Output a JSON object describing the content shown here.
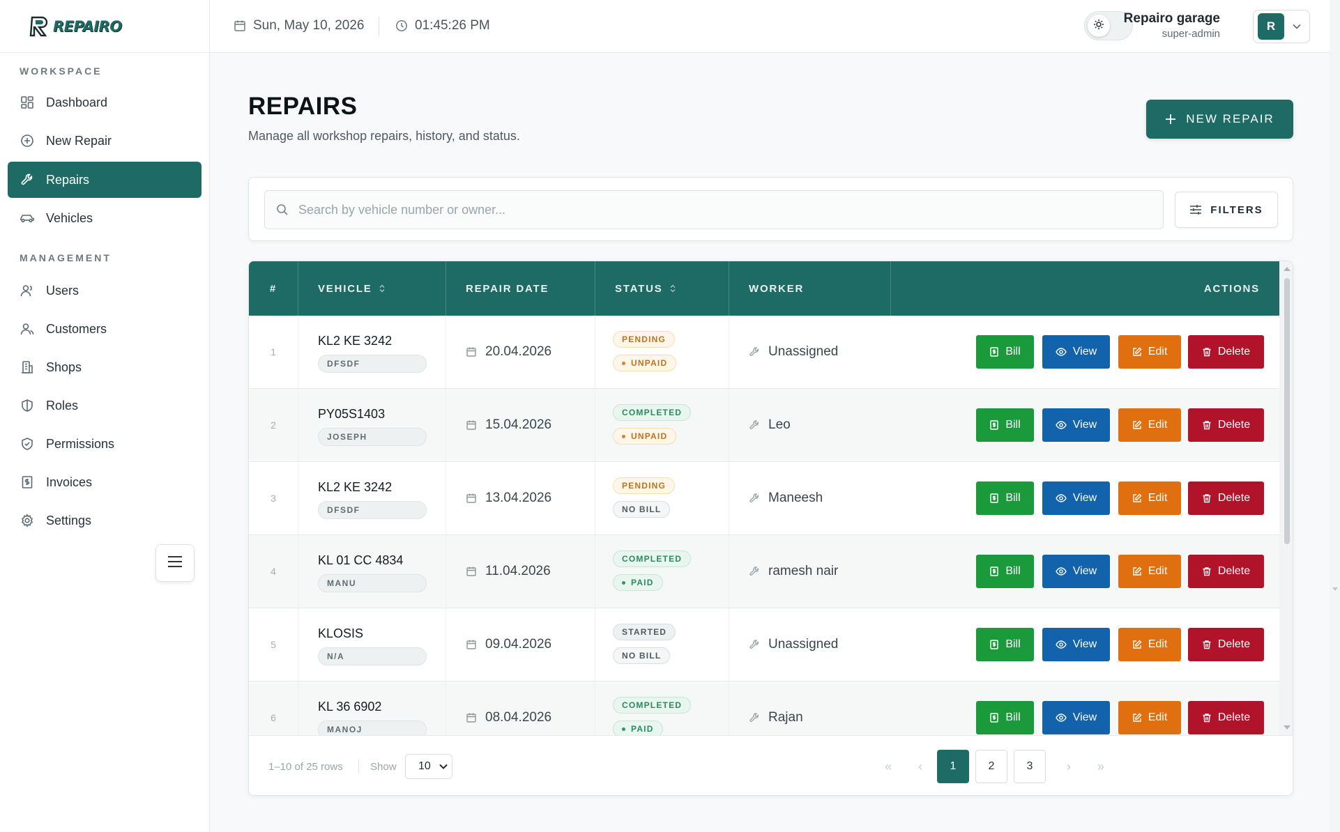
{
  "brand": {
    "name": "REPAIRO"
  },
  "sidebar": {
    "workspace_label": "WORKSPACE",
    "management_label": "MANAGEMENT",
    "workspace_items": [
      {
        "label": "Dashboard",
        "icon": "dashboard-icon"
      },
      {
        "label": "New Repair",
        "icon": "plus-circle-icon"
      },
      {
        "label": "Repairs",
        "icon": "wrench-icon",
        "active": true
      },
      {
        "label": "Vehicles",
        "icon": "car-icon"
      }
    ],
    "management_items": [
      {
        "label": "Users",
        "icon": "user-icon"
      },
      {
        "label": "Customers",
        "icon": "users-icon"
      },
      {
        "label": "Shops",
        "icon": "building-icon"
      },
      {
        "label": "Roles",
        "icon": "shield-icon"
      },
      {
        "label": "Permissions",
        "icon": "shield-check-icon"
      },
      {
        "label": "Invoices",
        "icon": "invoice-icon"
      },
      {
        "label": "Settings",
        "icon": "gear-icon"
      }
    ]
  },
  "topbar": {
    "date": "Sun, May 10, 2026",
    "time": "01:45:26 PM",
    "user_name": "Repairo garage",
    "user_role": "super-admin",
    "avatar_letter": "R"
  },
  "page": {
    "title": "REPAIRS",
    "subtitle": "Manage all workshop repairs, history, and status.",
    "new_button": "NEW REPAIR"
  },
  "search": {
    "placeholder": "Search by vehicle number or owner...",
    "value": "",
    "filters_label": "FILTERS"
  },
  "table": {
    "columns": [
      "#",
      "VEHICLE",
      "REPAIR DATE",
      "STATUS",
      "WORKER",
      "ACTIONS"
    ],
    "actions": {
      "bill": "Bill",
      "view": "View",
      "edit": "Edit",
      "delete": "Delete"
    },
    "rows": [
      {
        "num": "1",
        "vehicle": "KL2 KE 3242",
        "owner": "DFSDF",
        "date": "20.04.2026",
        "status": "PENDING",
        "payment": "UNPAID",
        "worker": "Unassigned"
      },
      {
        "num": "2",
        "vehicle": "PY05S1403",
        "owner": "JOSEPH",
        "date": "15.04.2026",
        "status": "COMPLETED",
        "payment": "UNPAID",
        "worker": "Leo"
      },
      {
        "num": "3",
        "vehicle": "KL2 KE 3242",
        "owner": "DFSDF",
        "date": "13.04.2026",
        "status": "PENDING",
        "payment": "NO BILL",
        "worker": "Maneesh"
      },
      {
        "num": "4",
        "vehicle": "KL 01 CC 4834",
        "owner": "MANU",
        "date": "11.04.2026",
        "status": "COMPLETED",
        "payment": "PAID",
        "worker": "ramesh nair"
      },
      {
        "num": "5",
        "vehicle": "KLOSIS",
        "owner": "N/A",
        "date": "09.04.2026",
        "status": "STARTED",
        "payment": "NO BILL",
        "worker": "Unassigned"
      },
      {
        "num": "6",
        "vehicle": "KL 36 6902",
        "owner": "MANOJ",
        "date": "08.04.2026",
        "status": "COMPLETED",
        "payment": "PAID",
        "worker": "Rajan"
      }
    ]
  },
  "footer": {
    "rows_info": "1–10 of 25 rows",
    "show_label": "Show",
    "page_size": "10",
    "pages": [
      "1",
      "2",
      "3"
    ],
    "current_page": "1"
  },
  "colors": {
    "primary": "#1e6b66",
    "bill": "#1a9a3a",
    "view": "#1262ac",
    "edit": "#e0700f",
    "delete": "#b0132a"
  }
}
